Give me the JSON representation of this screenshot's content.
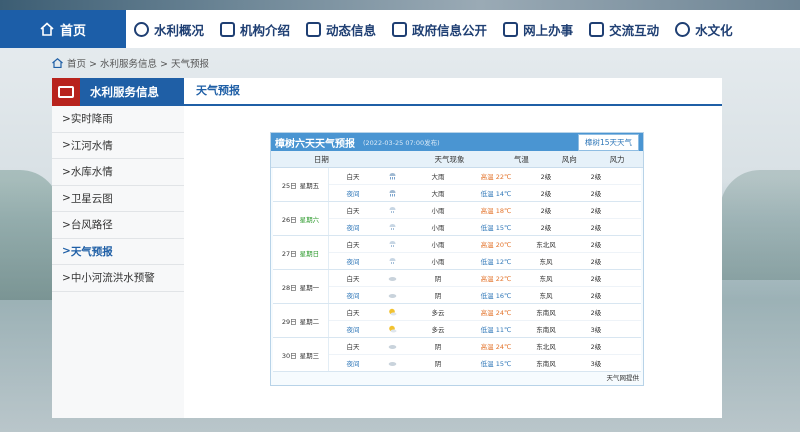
{
  "nav": {
    "home": "首页",
    "items": [
      "水利概况",
      "机构介绍",
      "动态信息",
      "政府信息公开",
      "网上办事",
      "交流互动",
      "水文化"
    ]
  },
  "breadcrumb": "首页 > 水利服务信息 > 天气预报",
  "sidebar": {
    "title": "水利服务信息",
    "items": [
      "实时降雨",
      "江河水情",
      "水库水情",
      "卫星云图",
      "台风路径",
      "天气预报",
      "中小河流洪水预警"
    ],
    "active_index": 5
  },
  "main": {
    "tab": "天气预报"
  },
  "forecast": {
    "title": "樟树六天天气预报",
    "published": "(2022-03-25 07:00发布)",
    "button": "樟树15天天气",
    "columns": [
      "日期",
      "天气现象",
      "气温",
      "风向",
      "风力"
    ],
    "source": "天气网提供",
    "days": [
      {
        "date": "25日",
        "weekday": "星期五",
        "weekday_color": "default",
        "day": {
          "part": "白天",
          "icon": "heavy-rain-icon",
          "weather": "大雨",
          "temp_label": "高温",
          "temp": "22℃",
          "dir": "2级",
          "pow": "2级"
        },
        "night": {
          "part": "夜间",
          "icon": "heavy-rain-icon",
          "weather": "大雨",
          "temp_label": "低温",
          "temp": "14℃",
          "dir": "2级",
          "pow": "2级"
        }
      },
      {
        "date": "26日",
        "weekday": "星期六",
        "weekday_color": "green",
        "day": {
          "part": "白天",
          "icon": "light-rain-icon",
          "weather": "小雨",
          "temp_label": "高温",
          "temp": "18℃",
          "dir": "2级",
          "pow": "2级"
        },
        "night": {
          "part": "夜间",
          "icon": "light-rain-icon",
          "weather": "小雨",
          "temp_label": "低温",
          "temp": "15℃",
          "dir": "2级",
          "pow": "2级"
        }
      },
      {
        "date": "27日",
        "weekday": "星期日",
        "weekday_color": "green",
        "day": {
          "part": "白天",
          "icon": "light-rain-icon",
          "weather": "小雨",
          "temp_label": "高温",
          "temp": "20℃",
          "dir": "东北风",
          "pow": "2级"
        },
        "night": {
          "part": "夜间",
          "icon": "light-rain-icon",
          "weather": "小雨",
          "temp_label": "低温",
          "temp": "12℃",
          "dir": "东风",
          "pow": "2级"
        }
      },
      {
        "date": "28日",
        "weekday": "星期一",
        "weekday_color": "default",
        "day": {
          "part": "白天",
          "icon": "overcast-icon",
          "weather": "阴",
          "temp_label": "高温",
          "temp": "22℃",
          "dir": "东风",
          "pow": "2级"
        },
        "night": {
          "part": "夜间",
          "icon": "overcast-icon",
          "weather": "阴",
          "temp_label": "低温",
          "temp": "16℃",
          "dir": "东风",
          "pow": "2级"
        }
      },
      {
        "date": "29日",
        "weekday": "星期二",
        "weekday_color": "default",
        "day": {
          "part": "白天",
          "icon": "partly-cloudy-icon",
          "weather": "多云",
          "temp_label": "高温",
          "temp": "24℃",
          "dir": "东南风",
          "pow": "2级"
        },
        "night": {
          "part": "夜间",
          "icon": "partly-cloudy-icon",
          "weather": "多云",
          "temp_label": "低温",
          "temp": "11℃",
          "dir": "东南风",
          "pow": "3级"
        }
      },
      {
        "date": "30日",
        "weekday": "星期三",
        "weekday_color": "default",
        "day": {
          "part": "白天",
          "icon": "overcast-icon",
          "weather": "阴",
          "temp_label": "高温",
          "temp": "24℃",
          "dir": "东北风",
          "pow": "2级"
        },
        "night": {
          "part": "夜间",
          "icon": "overcast-icon",
          "weather": "阴",
          "temp_label": "低温",
          "temp": "15℃",
          "dir": "东南风",
          "pow": "3级"
        }
      }
    ]
  },
  "colors": {
    "nav_blue": "#1c5ea8",
    "sidebar_red": "#d9322b",
    "header_blue": "#4a95d2",
    "high_temp": "#e3732a",
    "low_temp": "#2f77b8"
  }
}
